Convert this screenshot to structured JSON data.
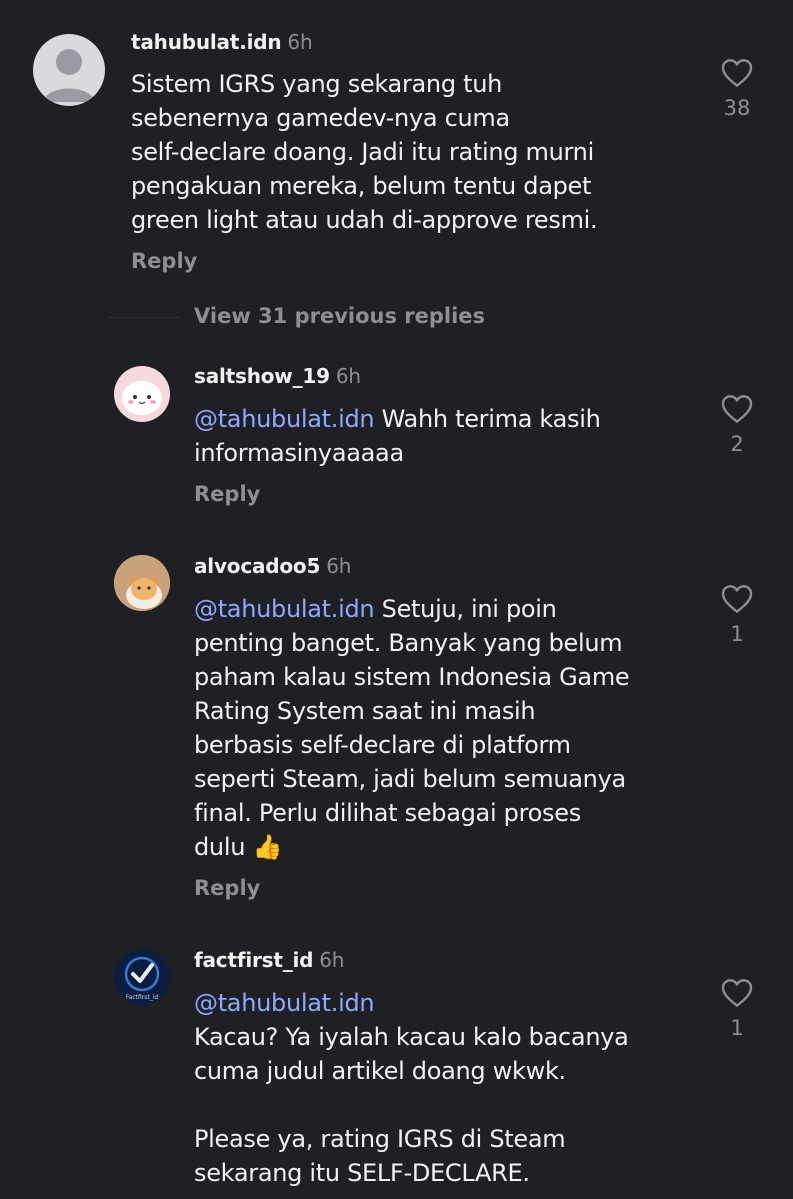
{
  "comments": [
    {
      "username": "tahubulat.idn",
      "time": "6h",
      "lines": [
        "Sistem IGRS yang sekarang tuh",
        "sebenernya gamedev-nya cuma",
        "self-declare doang. Jadi itu rating murni",
        "pengakuan mereka, belum tentu dapet",
        "green light atau udah di-approve resmi."
      ],
      "reply_label": "Reply",
      "likes": "38"
    }
  ],
  "view_previous": "View 31 previous replies",
  "replies": [
    {
      "username": "saltshow_19",
      "time": "6h",
      "mention": "@tahubulat.idn",
      "lines": [
        "Wahh terima kasih",
        "informasinyaaaaa"
      ],
      "reply_label": "Reply",
      "likes": "2"
    },
    {
      "username": "alvocadoo5",
      "time": "6h",
      "mention": "@tahubulat.idn",
      "lines": [
        "Setuju, ini poin",
        "penting banget. Banyak yang belum",
        "paham kalau sistem Indonesia Game",
        "Rating System saat ini masih",
        "berbasis self-declare di platform",
        "seperti Steam, jadi belum semuanya",
        "final. Perlu dilihat sebagai proses",
        "dulu 👍"
      ],
      "reply_label": "Reply",
      "likes": "1"
    },
    {
      "username": "factfirst_id",
      "time": "6h",
      "mention": "@tahubulat.idn",
      "avatar_caption": "Factfirst_id",
      "lines": [
        "Kacau? Ya iyalah kacau kalo bacanya",
        "cuma judul artikel doang wkwk.",
        "",
        "Please ya, rating IGRS di Steam",
        "sekarang itu SELF-DECLARE."
      ],
      "likes": "1"
    }
  ],
  "icons": {
    "heart": "heart-icon",
    "mention_prefix": "threads-mention-icon"
  },
  "colors": {
    "background": "#1f2024",
    "text": "#f2f2f2",
    "muted": "#8e8e93",
    "mention": "#8fa8ff"
  }
}
